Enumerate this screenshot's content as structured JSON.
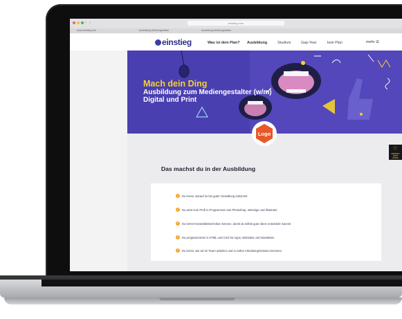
{
  "browser": {
    "address": "einstieg.com",
    "tabs": [
      "www.einstieg.com",
      "Ausbildung Mediengestalter",
      "Ausbildung Mediengestalter"
    ]
  },
  "header": {
    "logo_text": "einstieg",
    "nav": [
      {
        "label": "Was ist dein Plan?",
        "bold": true
      },
      {
        "label": "Ausbildung",
        "bold": true
      },
      {
        "label": "Studium",
        "bold": false
      },
      {
        "label": "Gap-Year",
        "bold": false
      },
      {
        "label": "kein Plan",
        "bold": false
      }
    ],
    "more_label": "mehr"
  },
  "hero": {
    "title": "Mach dein Ding",
    "subtitle": "Ausbildung zum Mediengestalter (w/m) Digital und Print"
  },
  "badge": {
    "label": "Logo"
  },
  "section": {
    "title": "Das machst du in der Ausbildung",
    "items": [
      "Du lernst, worauf es bei guter Gestaltung ankommt",
      "Du wirst zum Profi in Programmen wie Photoshop, InDesign und Illustrator",
      "Du lernst Kreativitätstechniken kennen, damit du selbst gute Ideen entwickeln kannst",
      "Du programmierst in HTML und CSS für Apps, Websites und Newsletter",
      "Du lernst, wie wir im Team arbeiten und zu tollen Arbeitsergebnissen kommen"
    ]
  },
  "side_widget": {
    "label": "MERKEN\nDEIN CHECK"
  },
  "colors": {
    "brand_blue": "#2b2f8a",
    "hero_purple": "#4a3fb0",
    "accent_yellow": "#f5d22e",
    "badge_orange": "#e8572a",
    "check_orange": "#f6a524"
  }
}
